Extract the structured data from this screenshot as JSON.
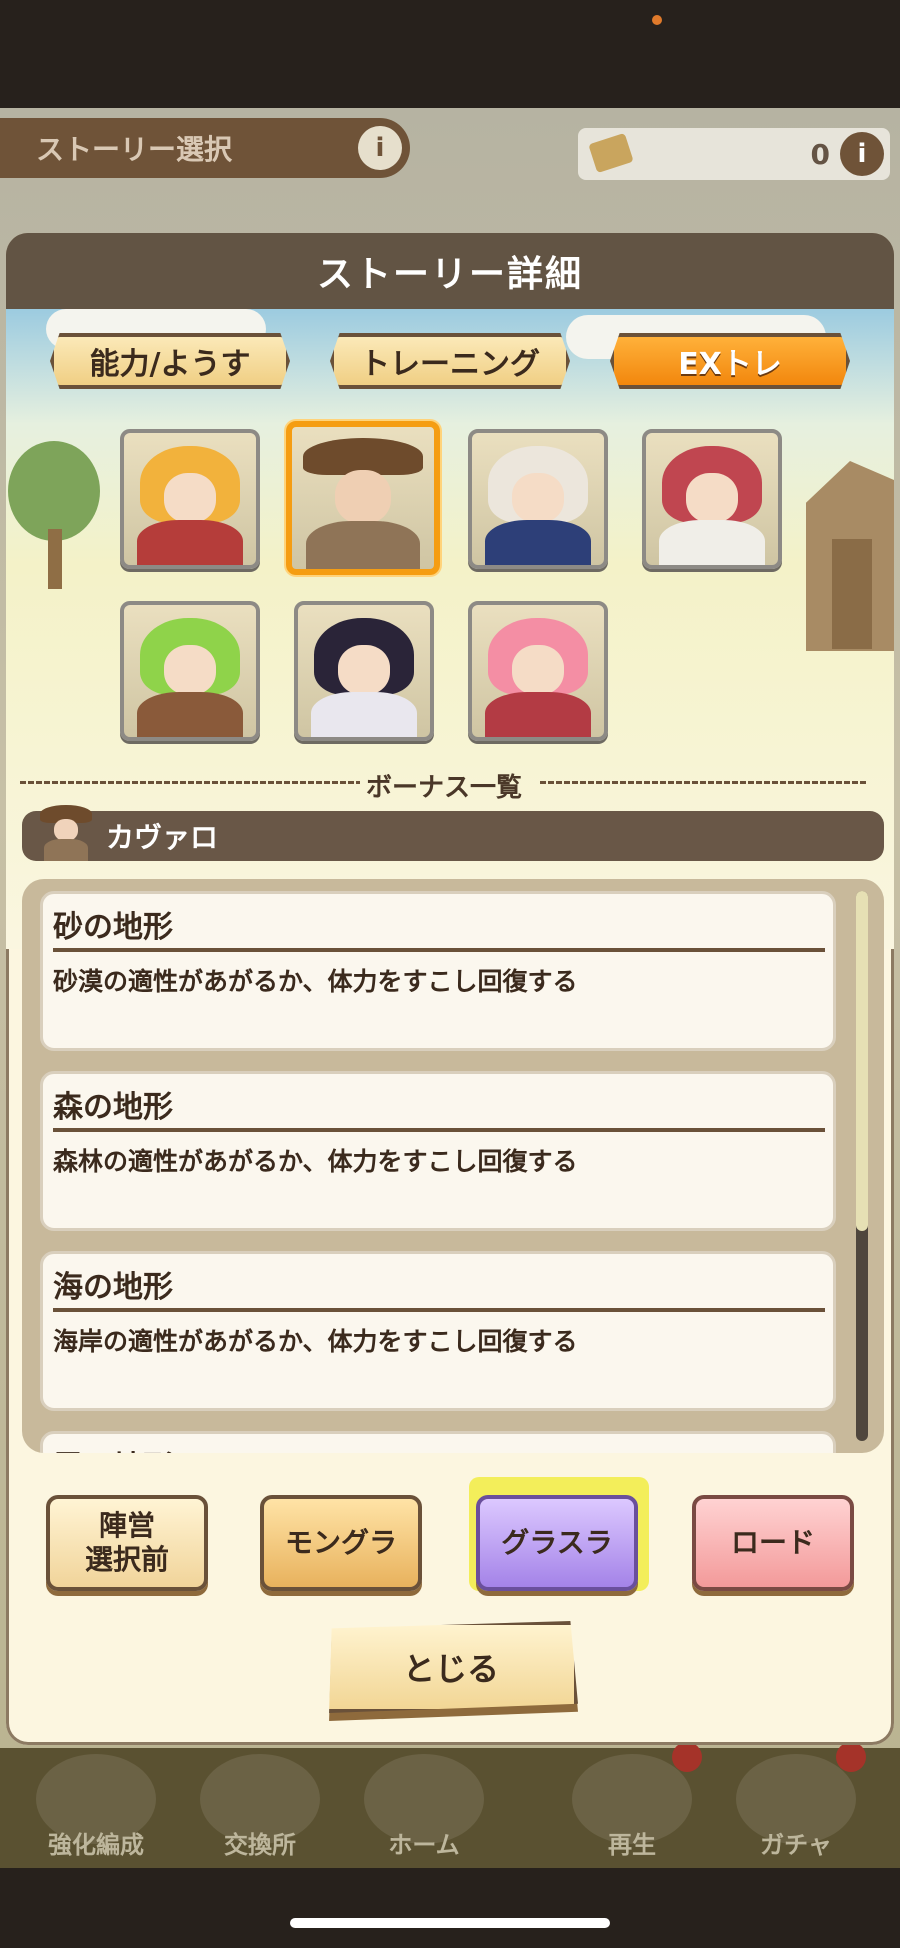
{
  "background": {
    "story_select_label": "ストーリー選択",
    "ticket_count": "0",
    "nav_items": [
      {
        "label": "強化編成"
      },
      {
        "label": "交換所"
      },
      {
        "label": "ホーム"
      },
      {
        "label": "再生"
      },
      {
        "label": "ガチャ"
      }
    ]
  },
  "modal": {
    "title": "ストーリー詳細",
    "tabs": [
      {
        "label": "能力/ようす"
      },
      {
        "label": "トレーニング"
      },
      {
        "label": "EXトレ"
      }
    ],
    "bonus_title": "ボーナス一覧",
    "selected_character": "カヴァロ",
    "bonuses": [
      {
        "title": "砂の地形",
        "desc": "砂漠の適性があがるか、体力をすこし回復する"
      },
      {
        "title": "森の地形",
        "desc": "森林の適性があがるか、体力をすこし回復する"
      },
      {
        "title": "海の地形",
        "desc": "海岸の適性があがるか、体力をすこし回復する"
      },
      {
        "title": "雪の地形",
        "desc": ""
      }
    ],
    "mode_buttons": [
      {
        "label": "陣営\n選択前"
      },
      {
        "label": "モングラ"
      },
      {
        "label": "グラスラ"
      },
      {
        "label": "ロード"
      }
    ],
    "close_label": "とじる"
  },
  "colors": {
    "header": "#625444",
    "accent_orange": "#f2870d",
    "panel": "#fcf6e0",
    "selected_border": "#f59d12"
  }
}
